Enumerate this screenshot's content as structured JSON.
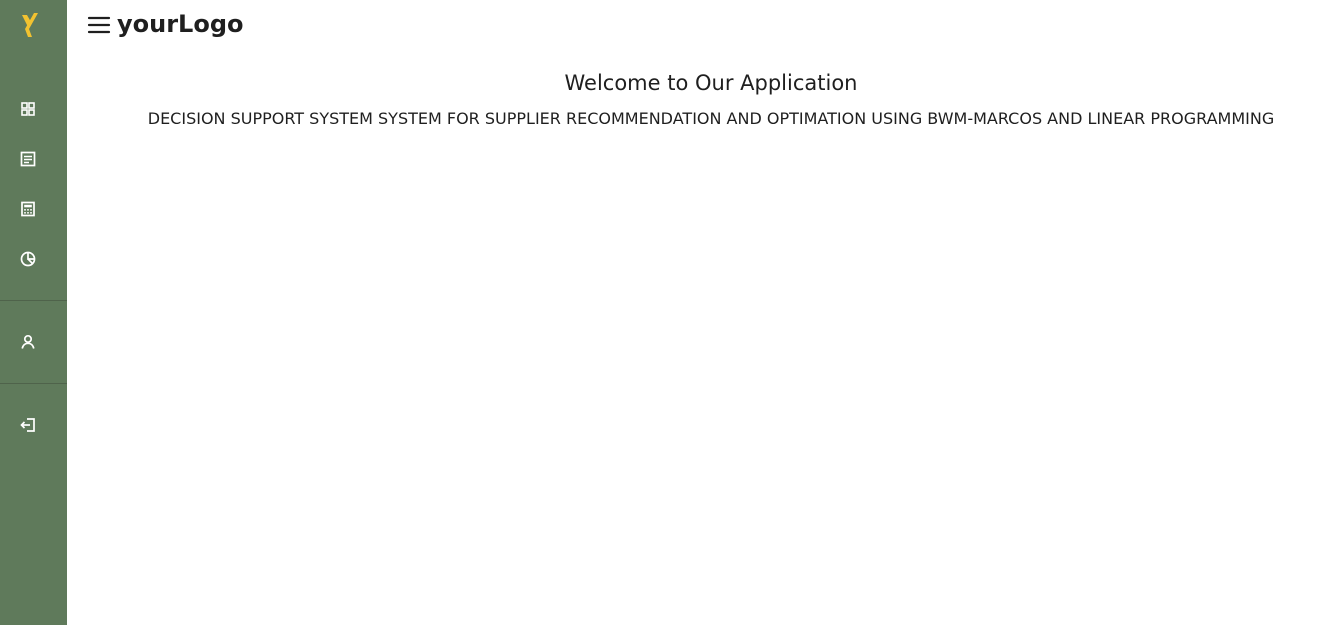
{
  "colors": {
    "sidebar": "#5f7a5b",
    "brand_accent": "#f2c230",
    "text": "#1f1f1f",
    "background": "#ffffff"
  },
  "sidebar": {
    "brand_icon": "brand-icon",
    "items": [
      {
        "icon": "dashboard-icon"
      },
      {
        "icon": "document-icon"
      },
      {
        "icon": "calculator-icon"
      },
      {
        "icon": "chart-icon"
      }
    ],
    "secondary_items": [
      {
        "icon": "user-icon"
      }
    ],
    "footer_items": [
      {
        "icon": "logout-icon"
      }
    ]
  },
  "header": {
    "menu_icon": "menu-icon",
    "logo_text": "yourLogo"
  },
  "main": {
    "welcome_title": "Welcome to Our Application",
    "subtitle": "DECISION SUPPORT SYSTEM SYSTEM FOR SUPPLIER RECOMMENDATION AND OPTIMATION USING BWM-MARCOS AND LINEAR PROGRAMMING"
  }
}
